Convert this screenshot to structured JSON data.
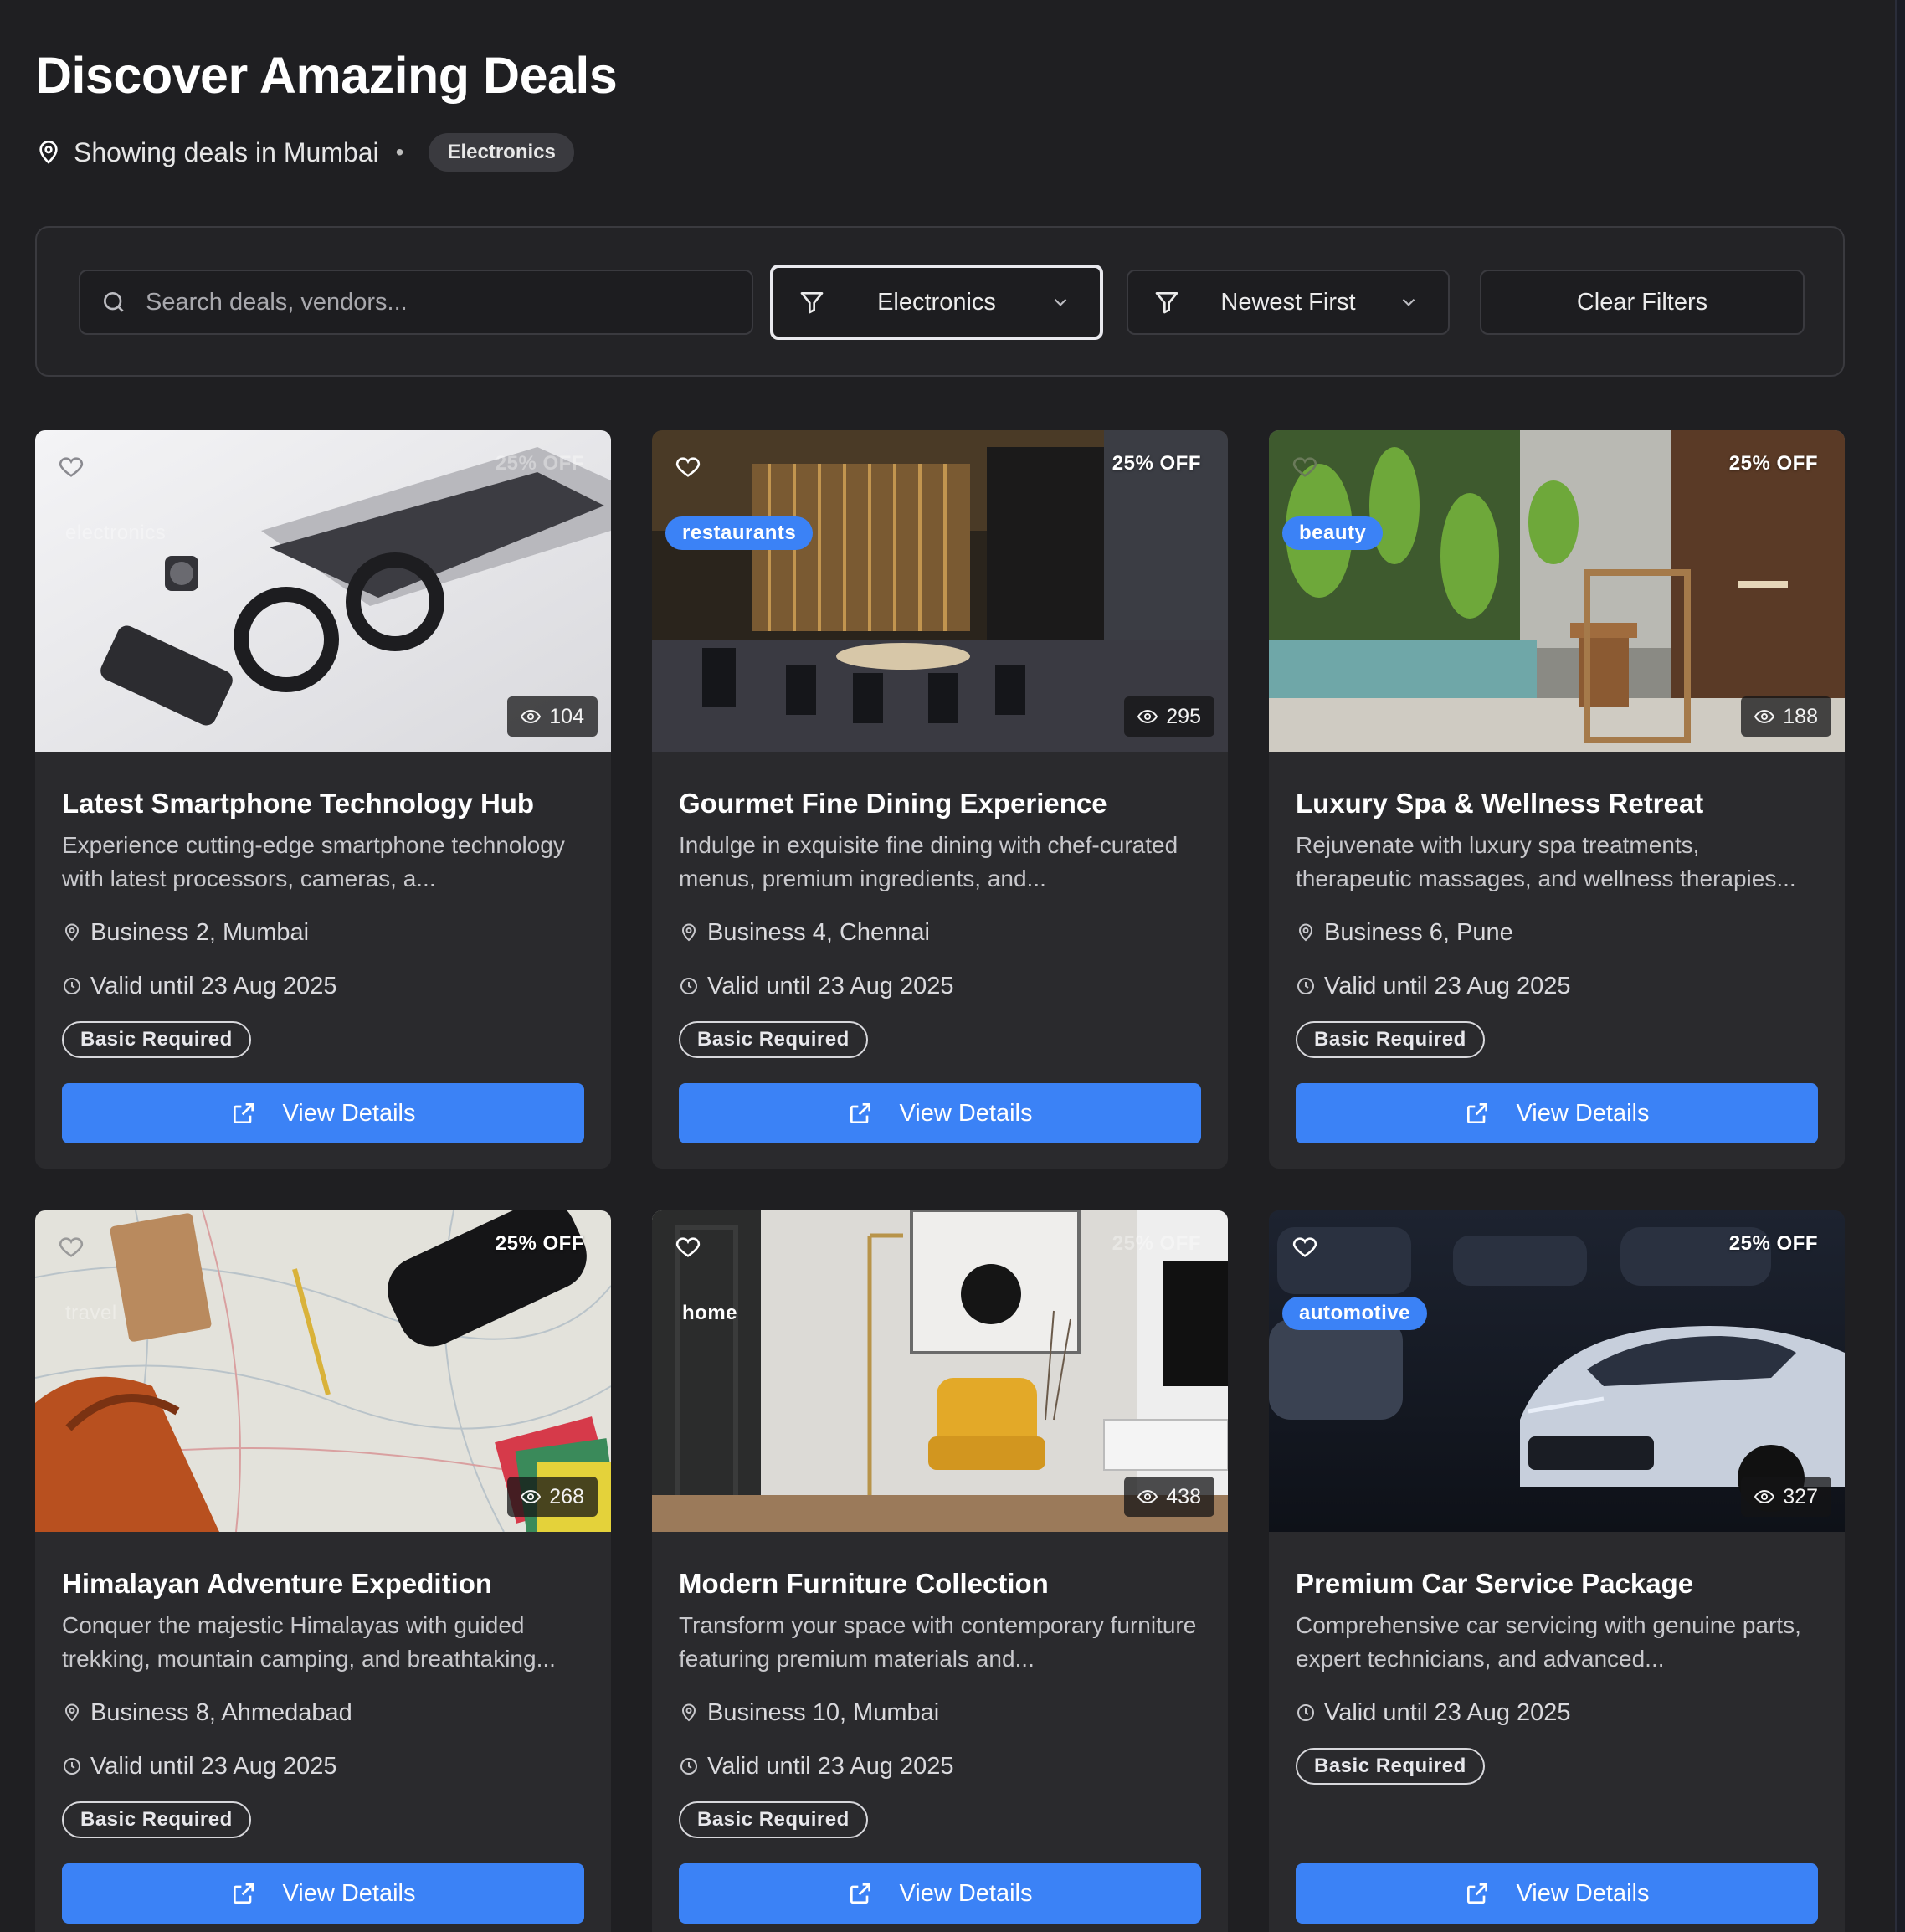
{
  "header": {
    "title": "Discover Amazing Deals",
    "location_text": "Showing deals in Mumbai",
    "separator": "•",
    "active_category_chip": "Electronics"
  },
  "filters": {
    "search_placeholder": "Search deals, vendors...",
    "search_value": "",
    "category_value": "Electronics",
    "sort_value": "Newest First",
    "clear_label": "Clear Filters"
  },
  "cards": [
    {
      "title": "Latest Smartphone Technology Hub",
      "description": "Experience cutting-edge smartphone technology with latest processors, cameras, a...",
      "location": "Business 2, Mumbai",
      "validity": "Valid until 23 Aug 2025",
      "badge": "Basic Required",
      "discount": "25% OFF",
      "category": "electronics",
      "views": "104",
      "button": "View Details"
    },
    {
      "title": "Gourmet Fine Dining Experience",
      "description": "Indulge in exquisite fine dining with chef-curated menus, premium ingredients, and...",
      "location": "Business 4, Chennai",
      "validity": "Valid until 23 Aug 2025",
      "badge": "Basic Required",
      "discount": "25% OFF",
      "category": "restaurants",
      "views": "295",
      "button": "View Details"
    },
    {
      "title": "Luxury Spa & Wellness Retreat",
      "description": "Rejuvenate with luxury spa treatments, therapeutic massages, and wellness therapies...",
      "location": "Business 6, Pune",
      "validity": "Valid until 23 Aug 2025",
      "badge": "Basic Required",
      "discount": "25% OFF",
      "category": "beauty",
      "views": "188",
      "button": "View Details"
    },
    {
      "title": "Himalayan Adventure Expedition",
      "description": "Conquer the majestic Himalayas with guided trekking, mountain camping, and breathtaking...",
      "location": "Business 8, Ahmedabad",
      "validity": "Valid until 23 Aug 2025",
      "badge": "Basic Required",
      "discount": "25% OFF",
      "category": "travel",
      "views": "268",
      "button": "View Details"
    },
    {
      "title": "Modern Furniture Collection",
      "description": "Transform your space with contemporary furniture featuring premium materials and...",
      "location": "Business 10, Mumbai",
      "validity": "Valid until 23 Aug 2025",
      "badge": "Basic Required",
      "discount": "25% OFF",
      "category": "home",
      "views": "438",
      "button": "View Details"
    },
    {
      "title": "Premium Car Service Package",
      "description": "Comprehensive car servicing with genuine parts, expert technicians, and advanced...",
      "validity": "Valid until 23 Aug 2025",
      "badge": "Basic Required",
      "discount": "25% OFF",
      "category": "automotive",
      "views": "327",
      "button": "View Details"
    }
  ],
  "colors": {
    "background": "#1f1f22",
    "card": "#2a2a2d",
    "accent": "#3b82f6"
  }
}
